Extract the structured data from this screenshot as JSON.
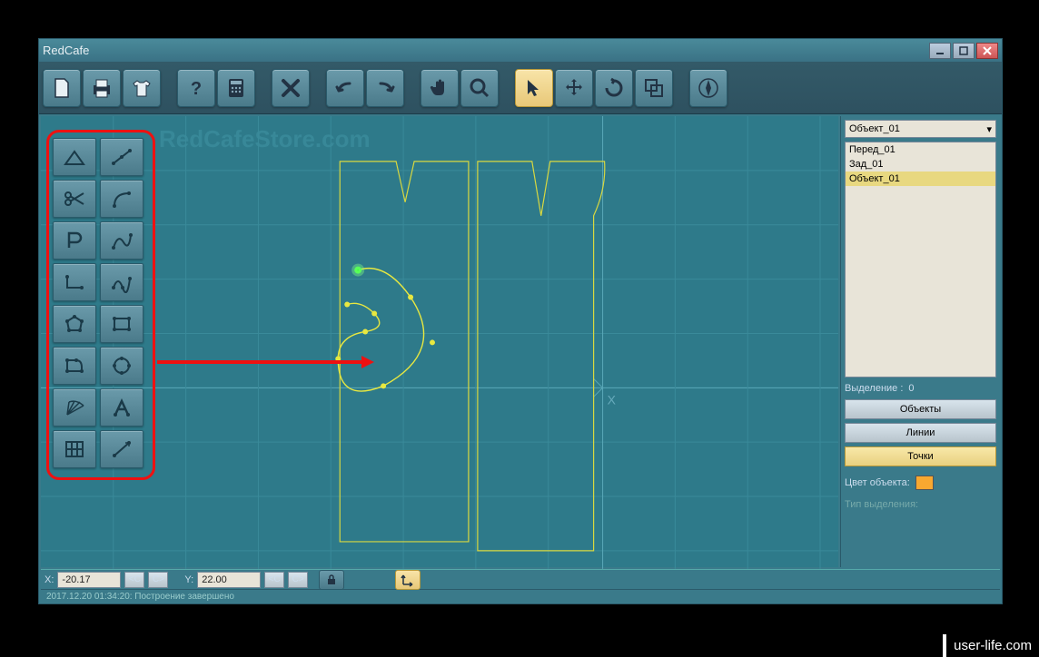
{
  "title": "RedCafe",
  "watermark": "RedCafeStore.com",
  "toolbar": {
    "reset_label": "Сброс"
  },
  "objects": {
    "selected": "Объект_01",
    "list": [
      "Перед_01",
      "Зад_01",
      "Объект_01"
    ]
  },
  "selection": {
    "label": "Выделение :",
    "count": "0"
  },
  "panel_buttons": {
    "objects": "Объекты",
    "lines": "Линии",
    "points": "Точки"
  },
  "color": {
    "label": "Цвет объекта:",
    "value": "#f8a830"
  },
  "sel_type_label": "Тип выделения:",
  "coords": {
    "x_label": "X:",
    "x_value": "-20.17",
    "y_label": "Y:",
    "y_value": "22.00",
    "c_left": "<C",
    "c_right": "C>"
  },
  "status": "2017.12.20 01:34:20: Построение завершено",
  "brand": "user-life.com"
}
